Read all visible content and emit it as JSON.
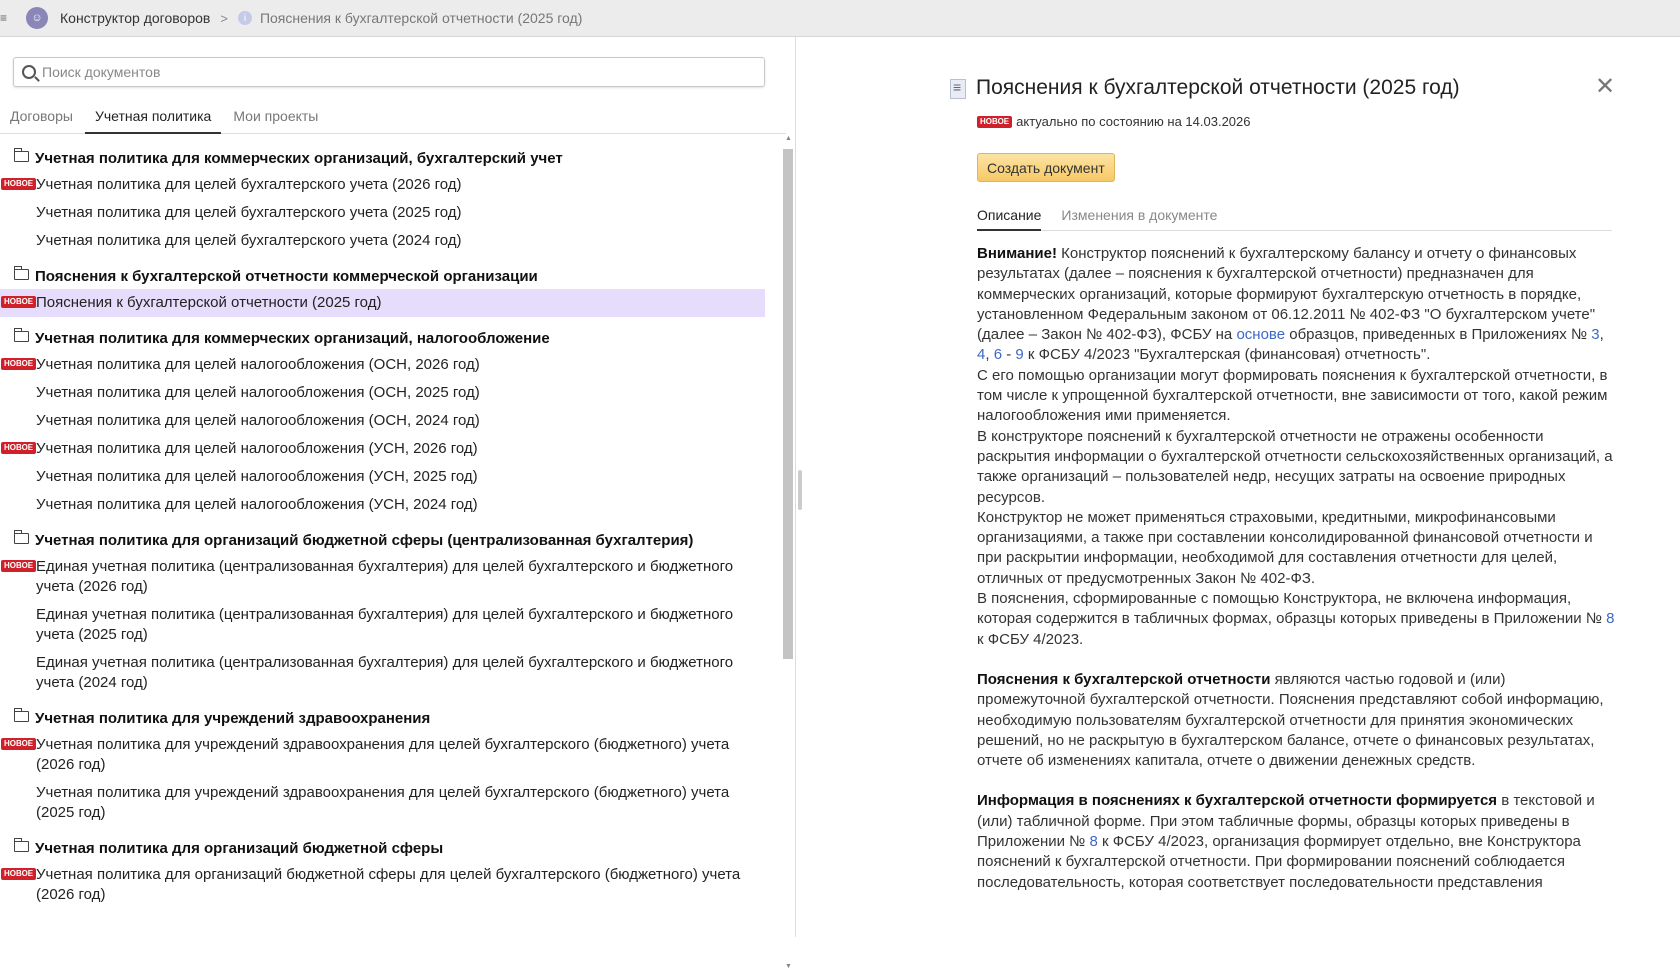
{
  "topbar": {
    "app_title": "Конструктор договоров",
    "current_doc": "Пояснения к бухгалтерской отчетности (2025 год)"
  },
  "search": {
    "placeholder": "Поиск документов",
    "value": ""
  },
  "left_tabs": [
    {
      "label": "Договоры",
      "active": false
    },
    {
      "label": "Учетная политика",
      "active": true
    },
    {
      "label": "Мои проекты",
      "active": false
    }
  ],
  "new_badge": "НОВОЕ",
  "colors": {
    "badge": "#d0212b",
    "selected_row": "#e6dcfb",
    "button": "#f6c966",
    "link": "#3f67c7"
  },
  "groups": [
    {
      "title": "Учетная политика для коммерческих организаций, бухгалтерский учет",
      "items": [
        {
          "label": "Учетная политика для целей бухгалтерского учета (2026 год)",
          "new": true
        },
        {
          "label": "Учетная политика для целей бухгалтерского учета (2025 год)",
          "new": false
        },
        {
          "label": "Учетная политика для целей бухгалтерского учета (2024 год)",
          "new": false
        }
      ]
    },
    {
      "title": "Пояснения к бухгалтерской отчетности коммерческой организации",
      "items": [
        {
          "label": "Пояснения к бухгалтерской отчетности (2025 год)",
          "new": true,
          "selected": true
        }
      ]
    },
    {
      "title": "Учетная политика для коммерческих организаций, налогообложение",
      "items": [
        {
          "label": "Учетная политика для целей налогообложения (ОСН, 2026 год)",
          "new": true
        },
        {
          "label": "Учетная политика для целей налогообложения (ОСН, 2025 год)",
          "new": false
        },
        {
          "label": "Учетная политика для целей налогообложения (ОСН, 2024 год)",
          "new": false
        },
        {
          "label": "Учетная политика для целей налогообложения (УСН, 2026 год)",
          "new": true
        },
        {
          "label": "Учетная политика для целей налогообложения (УСН, 2025 год)",
          "new": false
        },
        {
          "label": "Учетная политика для целей налогообложения (УСН, 2024 год)",
          "new": false
        }
      ]
    },
    {
      "title": "Учетная политика для организаций бюджетной сферы (централизованная бухгалтерия)",
      "items": [
        {
          "label": "Единая учетная политика (централизованная бухгалтерия) для целей бухгалтерского и бюджетного учета (2026 год)",
          "new": true
        },
        {
          "label": "Единая учетная политика (централизованная бухгалтерия) для целей бухгалтерского и бюджетного учета (2025 год)",
          "new": false
        },
        {
          "label": "Единая учетная политика (централизованная бухгалтерия) для целей бухгалтерского и бюджетного учета (2024 год)",
          "new": false
        }
      ]
    },
    {
      "title": "Учетная политика для учреждений здравоохранения",
      "items": [
        {
          "label": "Учетная политика для учреждений здравоохранения для целей бухгалтерского (бюджетного) учета (2026 год)",
          "new": true
        },
        {
          "label": "Учетная политика для учреждений здравоохранения для целей бухгалтерского (бюджетного) учета (2025 год)",
          "new": false
        }
      ]
    },
    {
      "title": "Учетная политика для организаций бюджетной сферы",
      "items": [
        {
          "label": "Учетная политика для организаций бюджетной сферы для целей бухгалтерского (бюджетного) учета (2026 год)",
          "new": true
        }
      ]
    }
  ],
  "detail": {
    "title": "Пояснения к бухгалтерской отчетности (2025 год)",
    "status": "актуально по состоянию на 14.03.2026",
    "create_button": "Создать документ",
    "tabs": [
      {
        "label": "Описание",
        "active": true
      },
      {
        "label": "Изменения в документе",
        "active": false
      }
    ],
    "paragraphs": [
      [
        {
          "t": "Внимание!",
          "b": true
        },
        {
          "t": " Конструктор пояснений к бухгалтерскому балансу и отчету о финансовых результатах (далее – пояснения к бухгалтерской отчетности) предназначен для коммерческих организаций, которые формируют бухгалтерскую отчетность в порядке, установленном Федеральным законом от 06.12.2011 № 402-ФЗ \"О бухгалтерском учете\" (далее – Закон № 402-ФЗ), ФСБУ на "
        },
        {
          "t": "основе",
          "link": true
        },
        {
          "t": " образцов, приведенных в Приложениях № "
        },
        {
          "t": "3",
          "link": true
        },
        {
          "t": ", "
        },
        {
          "t": "4",
          "link": true
        },
        {
          "t": ", "
        },
        {
          "t": "6",
          "link": true
        },
        {
          "t": " - "
        },
        {
          "t": "9",
          "link": true
        },
        {
          "t": " к ФСБУ 4/2023 \"Бухгалтерская (финансовая) отчетность\"."
        }
      ],
      [
        {
          "t": "С его помощью организации могут формировать пояснения к бухгалтерской отчетности, в том числе к упрощенной бухгалтерской отчетности, вне зависимости от того, какой режим налогообложения ими применяется."
        }
      ],
      [
        {
          "t": "В конструкторе пояснений к бухгалтерской отчетности не отражены особенности раскрытия информации о бухгалтерской отчетности сельскохозяйственных организаций, а также организаций – пользователей недр, несущих затраты на освоение природных ресурсов."
        }
      ],
      [
        {
          "t": "Конструктор не может применяться страховыми, кредитными, микрофинансовыми организациями, а также при составлении консолидированной финансовой отчетности и при раскрытии информации, необходимой для составления отчетности для целей, отличных от предусмотренных Закон № 402-ФЗ."
        }
      ],
      [
        {
          "t": "В пояснения, сформированные с помощью Конструктора, не включена информация, которая содержится в табличных формах, образцы которых приведены в Приложении № "
        },
        {
          "t": "8",
          "link": true
        },
        {
          "t": " к ФСБУ 4/2023."
        }
      ],
      [
        {
          "t": "Пояснения к бухгалтерской отчетности",
          "b": true
        },
        {
          "t": " являются частью годовой и (или) промежуточной бухгалтерской отчетности. Пояснения представляют собой информацию, необходимую пользователям бухгалтерской отчетности для принятия экономических решений, но не раскрытую в бухгалтерском балансе, отчете о финансовых результатах, отчете об изменениях капитала, отчете о движении денежных средств."
        }
      ],
      [
        {
          "t": "Информация в пояснениях к бухгалтерской отчетности формируется",
          "b": true
        },
        {
          "t": " в текстовой и (или) табличной форме. При этом табличные формы, образцы которых приведены в Приложении № "
        },
        {
          "t": "8",
          "link": true
        },
        {
          "t": " к ФСБУ 4/2023, организация формирует отдельно, вне Конструктора пояснений к бухгалтерской отчетности. При формировании пояснений соблюдается последовательность, которая соответствует последовательности представления"
        }
      ]
    ]
  }
}
